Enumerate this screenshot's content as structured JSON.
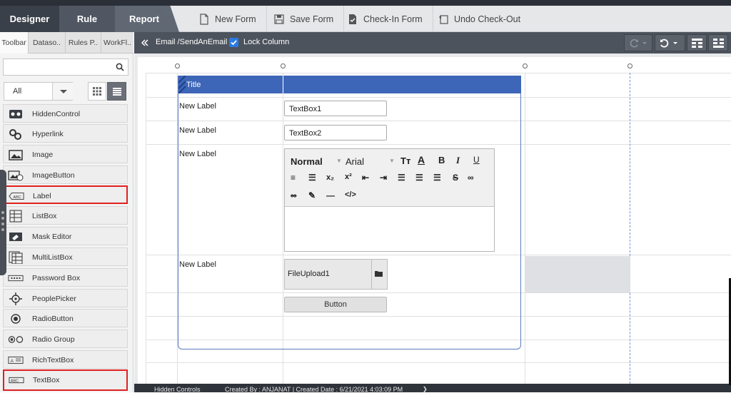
{
  "tabs": {
    "designer": "Designer",
    "rule": "Rule",
    "report": "Report"
  },
  "actions": [
    {
      "label": "New Form",
      "icon": "document-icon"
    },
    {
      "label": "Save Form",
      "icon": "floppy-disk-icon"
    },
    {
      "label": "Check-In Form",
      "icon": "check-in-icon"
    },
    {
      "label": "Undo Check-Out",
      "icon": "undo-icon"
    }
  ],
  "panel_tabs": [
    "Toolbar",
    "Dataso..",
    "Rules P..",
    "WorkFl.."
  ],
  "search": {
    "placeholder": ""
  },
  "filter": {
    "selected": "All"
  },
  "toolbox": [
    {
      "label": "HiddenControl",
      "icon": "hidden-control-icon",
      "highlighted": false
    },
    {
      "label": "Hyperlink",
      "icon": "hyperlink-icon",
      "highlighted": false
    },
    {
      "label": "Image",
      "icon": "image-icon",
      "highlighted": false
    },
    {
      "label": "ImageButton",
      "icon": "image-button-icon",
      "highlighted": false
    },
    {
      "label": "Label",
      "icon": "label-icon",
      "highlighted": true
    },
    {
      "label": "ListBox",
      "icon": "listbox-icon",
      "highlighted": false
    },
    {
      "label": "Mask Editor",
      "icon": "mask-editor-icon",
      "highlighted": false
    },
    {
      "label": "MultiListBox",
      "icon": "multilistbox-icon",
      "highlighted": false
    },
    {
      "label": "Password Box",
      "icon": "password-box-icon",
      "highlighted": false
    },
    {
      "label": "PeoplePicker",
      "icon": "people-picker-icon",
      "highlighted": false
    },
    {
      "label": "RadioButton",
      "icon": "radio-button-icon",
      "highlighted": false
    },
    {
      "label": "Radio Group",
      "icon": "radio-group-icon",
      "highlighted": false
    },
    {
      "label": "RichTextBox",
      "icon": "rich-textbox-icon",
      "highlighted": false
    },
    {
      "label": "TextBox",
      "icon": "textbox-icon",
      "highlighted": true
    }
  ],
  "breadcrumb": "Email /SendAnEmail",
  "lock_column": {
    "label": "Lock Column",
    "checked": true
  },
  "form": {
    "title": "Title",
    "labels": [
      "New Label",
      "New Label",
      "New Label",
      "New Label"
    ],
    "textbox1": "TextBox1",
    "textbox2": "TextBox2",
    "rte": {
      "style": "Normal",
      "font": "Arial"
    },
    "fileupload": "FileUpload1",
    "button": "Button"
  },
  "status": {
    "hidden": "Hidden Controls",
    "created": "Created By : ANJANAT | Created Date : 6/21/2021 4:03:09 PM"
  },
  "colors": {
    "accent": "#3d66b8",
    "highlight": "#e02020",
    "header": "#3a4049"
  }
}
